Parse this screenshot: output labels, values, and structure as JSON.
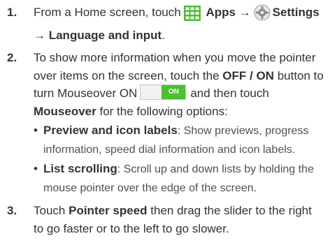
{
  "steps": [
    {
      "number": "1.",
      "t1": "From a Home screen, touch",
      "apps": "Apps",
      "arrow": "→",
      "settings": "Settings",
      "t2": "→ Language and input",
      "t3": "."
    },
    {
      "number": "2.",
      "t1": "To show more information when you move the pointer over items on the screen, touch the",
      "button_label": "OFF / ON",
      "t2": "button to turn Mouseover ON",
      "toggle_on": "ON",
      "t3": "and then touch",
      "mouseover": "Mouseover",
      "t4": "for the following options:",
      "bullets": [
        {
          "title": "Preview and icon labels",
          "text": ": Show previews, progress information, speed dial information and icon labels."
        },
        {
          "title": "List scrolling",
          "text": ": Scroll up and down lists by holding the mouse pointer over the edge of the screen."
        }
      ]
    },
    {
      "number": "3.",
      "t1": "Touch",
      "pointer_speed": "Pointer speed",
      "t2": "then drag the slider to the right to go faster or to the left to go slower."
    }
  ],
  "icons": {
    "apps": "apps-grid-icon",
    "settings": "settings-gear-icon"
  },
  "colors": {
    "apps_icon": "#4cbf32",
    "toggle_on": "#4cbf32"
  }
}
